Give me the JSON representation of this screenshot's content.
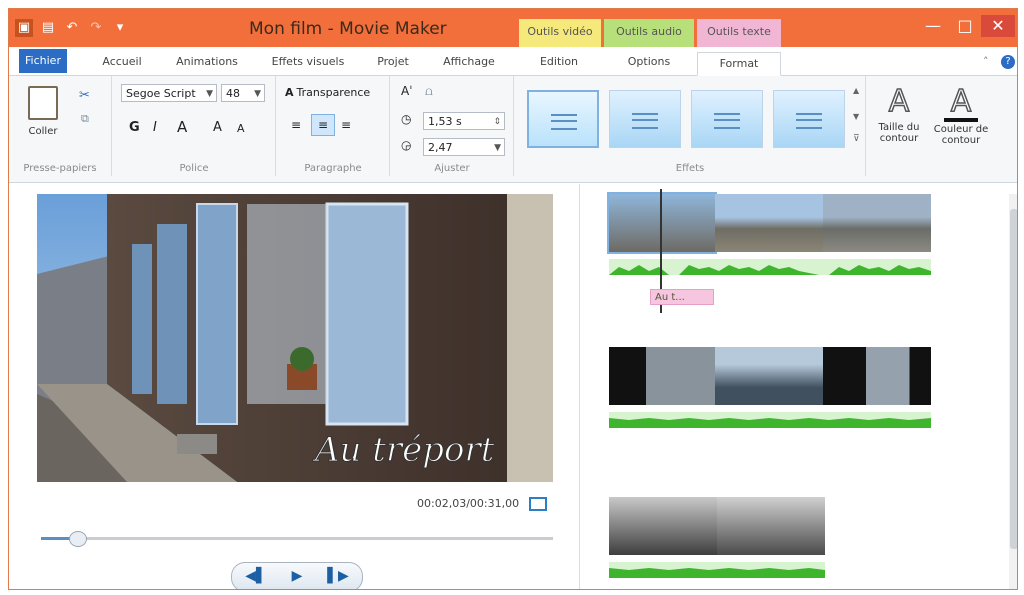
{
  "window": {
    "title": "Mon film - Movie Maker",
    "context_tabs": [
      "Outils vidéo",
      "Outils audio",
      "Outils texte"
    ]
  },
  "qat_icons": [
    "app-icon",
    "save-icon",
    "undo-icon",
    "redo-icon",
    "customize-icon"
  ],
  "tabs": {
    "file": "Fichier",
    "items": [
      "Accueil",
      "Animations",
      "Effets visuels",
      "Projet",
      "Affichage",
      "Edition",
      "Options",
      "Format"
    ],
    "active": "Format"
  },
  "ribbon": {
    "clipboard": {
      "paste": "Coller",
      "group": "Presse-papiers"
    },
    "font": {
      "family": "Segoe Script",
      "size": "48",
      "bold": "G",
      "italic": "I",
      "color": "A",
      "grow": "A",
      "shrink": "A",
      "group": "Police"
    },
    "paragraph": {
      "transparency": "Transparence",
      "group": "Paragraphe"
    },
    "adjust": {
      "start": "1,53 s",
      "duration": "2,47",
      "group": "Ajuster"
    },
    "effects": {
      "group": "Effets"
    },
    "outline_size": "Taille du contour",
    "outline_color": "Couleur de contour"
  },
  "preview": {
    "caption": "Au tréport",
    "timecode": "00:02,03/00:31,00",
    "progress": 0.07
  },
  "timeline": {
    "caption_chip": "Au t..."
  },
  "colors": {
    "titlebar": "#f26f3b",
    "file_tab": "#2b6cc4",
    "audio_wave": "#3fb52e"
  }
}
